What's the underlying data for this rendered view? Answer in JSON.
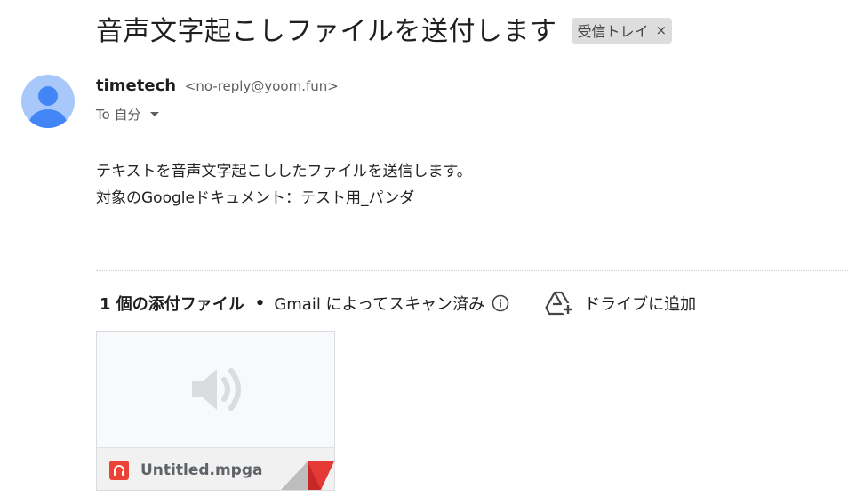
{
  "email": {
    "subject": "音声文字起こしファイルを送付します",
    "label_chip": "受信トレイ",
    "label_remove": "×",
    "sender": {
      "name": "timetech",
      "email": "<no-reply@yoom.fun>"
    },
    "to_line": "To 自分",
    "body_lines": [
      "テキストを音声文字起こししたファイルを送信します。",
      "対象のGoogleドキュメント：テスト用_パンダ"
    ]
  },
  "attachments": {
    "count_label": "1 個の添付ファイル",
    "separator": "•",
    "scan_text": "Gmail によってスキャン済み",
    "drive_label": "ドライブに追加",
    "files": [
      {
        "name": "Untitled.mpga",
        "type_icon": "headphones-icon",
        "preview_icon": "speaker-icon"
      }
    ]
  },
  "colors": {
    "avatar_bg": "#a8c7fa",
    "avatar_fg": "#4285f4",
    "file_icon": "#ea4335"
  }
}
